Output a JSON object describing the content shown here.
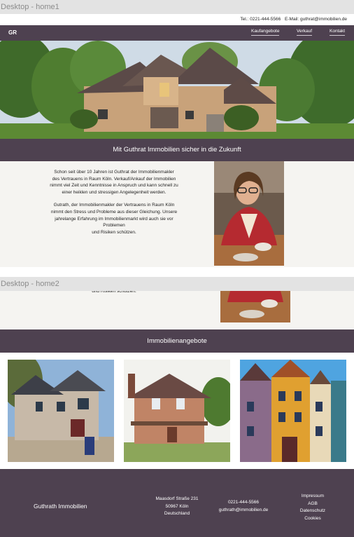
{
  "frames": {
    "home1": "Desktop - home1",
    "home2": "Desktop - home2"
  },
  "contact_bar": {
    "phone": "Tel.: 0221-444-5566",
    "email": "E-Mail: guthrat@immobilien.de"
  },
  "nav": {
    "logo": "GR",
    "links": [
      "Kaufangebote",
      "Verkauf",
      "Kontakt"
    ]
  },
  "tagline": "Mit Guthrat Immobilien sicher in die Zukunft",
  "intro": {
    "p1_lines": [
      "Schon seit über 10 Jahren ist Guthrat der Immobilienmakler",
      "des Vertrauens in Raum Köln. Verkauf/Ankauf der Immobilien",
      "nimmt viel Zeit und Kenntnisse in Anspruch und kann schnell zu",
      "einer heiklen und stressigen Angelegenheit werden."
    ],
    "p2_lines": [
      "Gutrath, der Immobilienmakler der Vertrauens in Raum Köln",
      "nimmt den Stress und Probleme aus dieser Gleichung. Unsere",
      "jahrelange Erfahrung im Immobilienmarkt wird auch sie vor",
      "Problemen",
      "und Risiken schützen."
    ]
  },
  "offers_title": "Immobilienangebote",
  "footer": {
    "brand": "Guthrath Immobilien",
    "address": [
      "Maasdorf Straße 231",
      "50967 Köln",
      "Deutschland"
    ],
    "contact": [
      "0221-444-5566",
      "guthrath@immobilien.de"
    ],
    "links": [
      "Impressum",
      "AGB",
      "Datenschutz",
      "Cookies"
    ]
  },
  "colors": {
    "brand": "#4e4150",
    "intro_bg": "#f5f4f1",
    "frame_label_bg": "#e3e3e3"
  }
}
